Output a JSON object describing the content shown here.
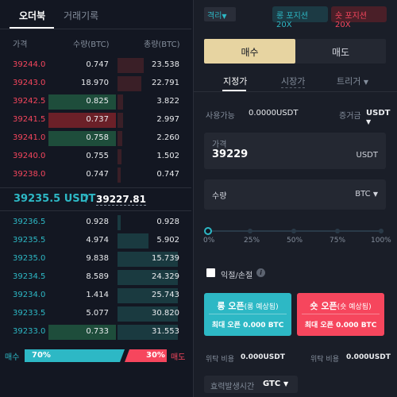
{
  "order_book": {
    "tabs": [
      "오더북",
      "거래기록"
    ],
    "headers": {
      "price": "가격",
      "qty": "수량(BTC)",
      "total": "총량(BTC)"
    },
    "asks": [
      {
        "price": "39244.0",
        "qty": "0.747",
        "total": "23.538",
        "depth": 0.35,
        "qty_highlight": ""
      },
      {
        "price": "39243.0",
        "qty": "18.970",
        "total": "22.791",
        "depth": 0.32,
        "qty_highlight": ""
      },
      {
        "price": "39242.5",
        "qty": "0.825",
        "total": "3.822",
        "depth": 0.08,
        "qty_highlight": "green"
      },
      {
        "price": "39241.5",
        "qty": "0.737",
        "total": "2.997",
        "depth": 0.07,
        "qty_highlight": "red"
      },
      {
        "price": "39241.0",
        "qty": "0.758",
        "total": "2.260",
        "depth": 0.06,
        "qty_highlight": "green"
      },
      {
        "price": "39240.0",
        "qty": "0.755",
        "total": "1.502",
        "depth": 0.05,
        "qty_highlight": ""
      },
      {
        "price": "39238.0",
        "qty": "0.747",
        "total": "0.747",
        "depth": 0.04,
        "qty_highlight": ""
      }
    ],
    "mid": {
      "price": "39235.5 USDT",
      "arrow": "↑",
      "mark": "39227.81"
    },
    "bids": [
      {
        "price": "39236.5",
        "qty": "0.928",
        "total": "0.928",
        "depth": 0.04,
        "qty_highlight": ""
      },
      {
        "price": "39235.5",
        "qty": "4.974",
        "total": "5.902",
        "depth": 0.42,
        "qty_highlight": ""
      },
      {
        "price": "39235.0",
        "qty": "9.838",
        "total": "15.739",
        "depth": 0.82,
        "qty_highlight": ""
      },
      {
        "price": "39234.5",
        "qty": "8.589",
        "total": "24.329",
        "depth": 0.82,
        "qty_highlight": ""
      },
      {
        "price": "39234.0",
        "qty": "1.414",
        "total": "25.743",
        "depth": 0.82,
        "qty_highlight": ""
      },
      {
        "price": "39233.5",
        "qty": "5.077",
        "total": "30.820",
        "depth": 0.82,
        "qty_highlight": ""
      },
      {
        "price": "39233.0",
        "qty": "0.733",
        "total": "31.553",
        "depth": 0.82,
        "qty_highlight": "green"
      }
    ],
    "ratio": {
      "buy_label": "매수",
      "buy_pct": "70%",
      "sell_pct": "30%",
      "sell_label": "매도",
      "buy_value": 70
    }
  },
  "order_form": {
    "margin_mode": "격리",
    "long_chip": "롱 포지션 20X",
    "short_chip": "숏 포지션 20X",
    "side_buy": "매수",
    "side_sell": "매도",
    "types": [
      "지정가",
      "시장가",
      "트리거"
    ],
    "available_label": "사용가능",
    "available_value": "0.0000USDT",
    "margin_label": "증거금",
    "margin_value": "USDT",
    "price_label": "가격",
    "price_value": "39229",
    "price_unit": "USDT",
    "qty_label": "수량",
    "qty_unit": "BTC",
    "slider_value": 0,
    "slider_labels": [
      "0%",
      "25%",
      "50%",
      "75%",
      "100%"
    ],
    "tpsl_label": "익절/손절",
    "long_button": {
      "main": "롱 오픈",
      "sub": "(롱 예상됨)",
      "max": "최대 오픈 0.000 BTC"
    },
    "short_button": {
      "main": "숏 오픈",
      "sub": "(숏 예상됨)",
      "max": "최대 오픈 0.000 BTC"
    },
    "fee_label": "위탁 비용",
    "fee_value_long": "0.000USDT",
    "fee_value_short": "0.000USDT",
    "tif_label": "효력발생시간",
    "tif_value": "GTC",
    "colors": {
      "accent_buy": "#2db8c5",
      "accent_sell": "#f6465d",
      "tab_gold": "#e7d4a1"
    }
  }
}
